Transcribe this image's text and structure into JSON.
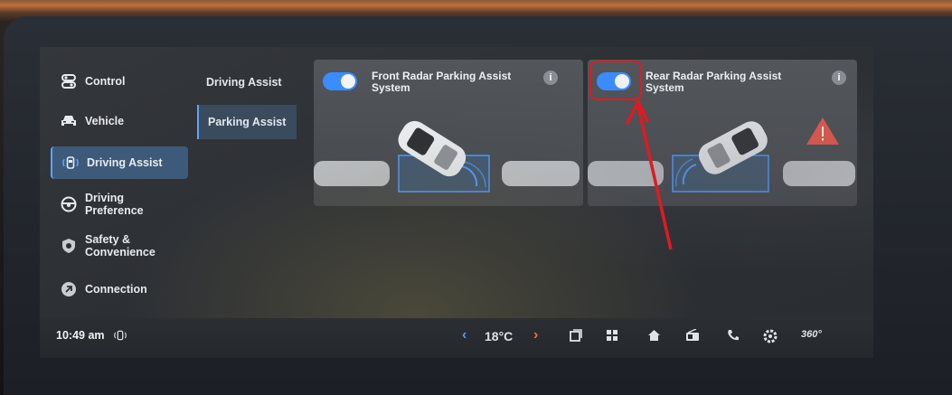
{
  "sidebar": {
    "items": [
      {
        "label": "Control",
        "icon": "control-icon"
      },
      {
        "label": "Vehicle",
        "icon": "car-icon"
      },
      {
        "label": "Driving Assist",
        "icon": "steering-assist-icon",
        "active": true
      },
      {
        "label_line1": "Driving",
        "label_line2": "Preference",
        "icon": "steering-wheel-icon"
      },
      {
        "label_line1": "Safety &",
        "label_line2": "Convenience",
        "icon": "shield-icon"
      },
      {
        "label": "Connection",
        "icon": "connection-icon"
      }
    ]
  },
  "subnav": {
    "items": [
      {
        "label": "Driving Assist"
      },
      {
        "label": "Parking Assist",
        "active": true
      }
    ]
  },
  "cards": {
    "front": {
      "title_line1": "Front Radar Parking Assist",
      "title_line2": "System",
      "enabled": true,
      "info": "i"
    },
    "rear": {
      "title_line1": "Rear Radar Parking Assist",
      "title_line2": "System",
      "enabled": true,
      "info": "i"
    }
  },
  "bottombar": {
    "time": "10:49 am",
    "temperature": "18°C",
    "left_chevron": "‹",
    "right_chevron": "›",
    "icons": [
      "status-assist-icon",
      "window-icon",
      "apps-grid-icon",
      "home-icon",
      "radio-icon",
      "phone-icon",
      "settings-icon",
      "360-view-icon"
    ],
    "view_label": "360°"
  },
  "colors": {
    "accent": "#3a8cff",
    "annotation": "#e01a22",
    "warning": "#e8584a"
  }
}
